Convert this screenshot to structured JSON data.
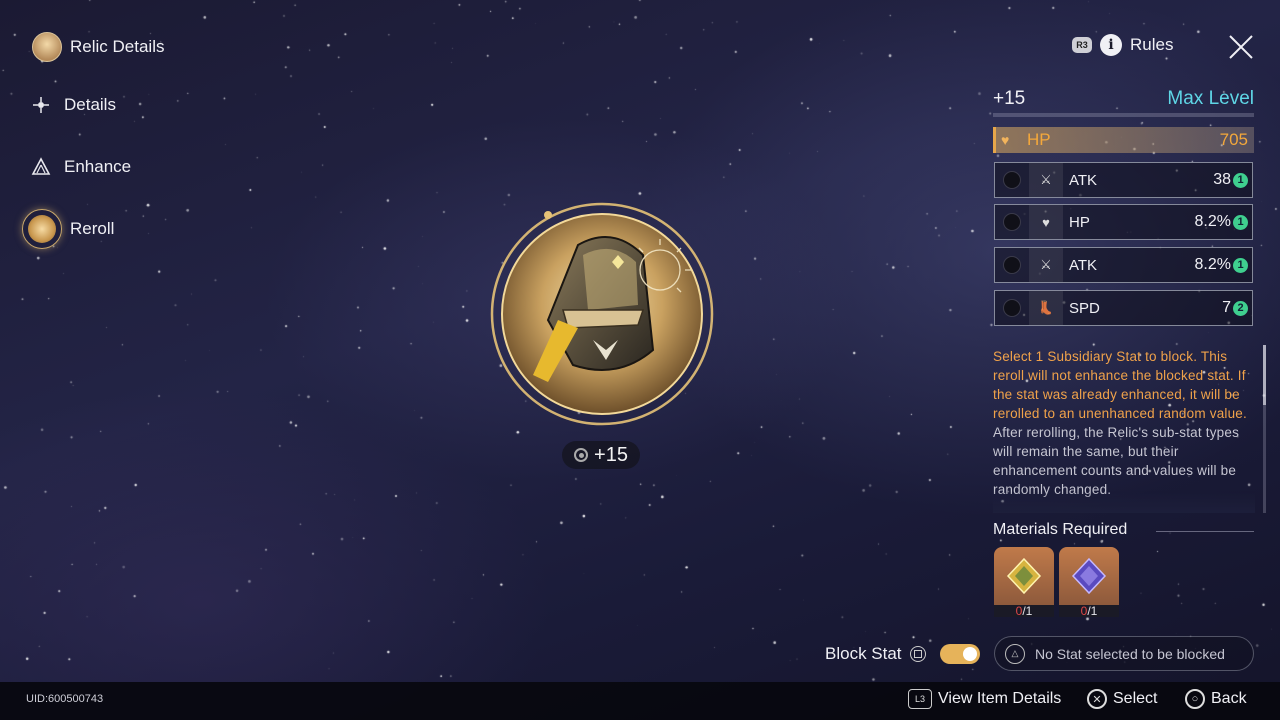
{
  "nav": {
    "title": "Relic Details",
    "items": [
      {
        "label": "Details"
      },
      {
        "label": "Enhance"
      },
      {
        "label": "Reroll"
      }
    ]
  },
  "header": {
    "rules_button_hint": "R3",
    "rules_label": "Rules"
  },
  "relic": {
    "level_text": "+15",
    "accent_color": "#e6c277"
  },
  "stats": {
    "level": "+15",
    "max_level_label": "Max Level",
    "main_stat": {
      "name": "HP",
      "value": "705",
      "icon": "heart-icon"
    },
    "sub_stats": [
      {
        "name": "ATK",
        "value": "38",
        "count": "1",
        "icon": "sword-icon"
      },
      {
        "name": "HP",
        "value": "8.2%",
        "count": "1",
        "icon": "heart-icon"
      },
      {
        "name": "ATK",
        "value": "8.2%",
        "count": "1",
        "icon": "sword-icon"
      },
      {
        "name": "SPD",
        "value": "7",
        "count": "2",
        "icon": "boot-icon"
      }
    ]
  },
  "description": {
    "warning": "Select 1 Subsidiary Stat to block. This reroll will not enhance the blocked stat. If the stat was already enhanced, it will be rerolled to an unenhanced random value.",
    "info": "After rerolling, the Relic's sub-stat types will remain the same, but their enhancement counts and values will be randomly changed."
  },
  "materials": {
    "title": "Materials Required",
    "items": [
      {
        "have": "0",
        "need": "/1",
        "icon": "gold-cube-icon"
      },
      {
        "have": "0",
        "need": "/1",
        "icon": "purple-cube-icon"
      }
    ]
  },
  "block": {
    "label": "Block Stat",
    "toggle_on": true,
    "status_text": "No Stat selected to be blocked"
  },
  "footer": {
    "uid": "UID:600500743",
    "view_item_hint": "L3",
    "view_item_label": "View Item Details",
    "select_label": "Select",
    "back_label": "Back"
  },
  "colors": {
    "warning": "#f0a24a",
    "max_level": "#5fd6e6",
    "main_stat": "#f4a83b",
    "count_badge": "#3fcf8f"
  }
}
